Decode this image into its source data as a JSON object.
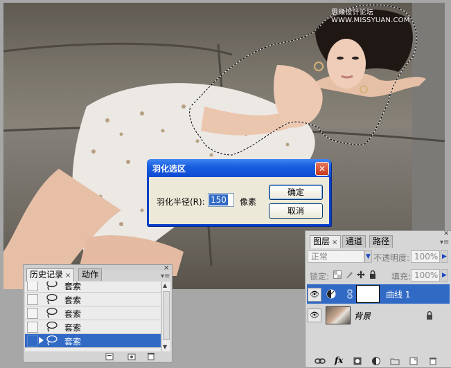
{
  "watermark": "思缘设计论坛 WWW.MISSYUAN.COM",
  "feather_dialog": {
    "title": "羽化选区",
    "radius_label": "羽化半径(R):",
    "radius_value": "150",
    "unit": "像素",
    "ok_label": "确定",
    "cancel_label": "取消",
    "close_glyph": "✕"
  },
  "history_panel": {
    "tabs": [
      {
        "label": "历史记录",
        "close": "×"
      },
      {
        "label": "动作"
      }
    ],
    "close_glyph": "×",
    "menu_glyph": "▾≡",
    "items": [
      {
        "label": "套索"
      },
      {
        "label": "套索"
      },
      {
        "label": "套索"
      },
      {
        "label": "套索"
      },
      {
        "label": "套索",
        "selected": true
      }
    ],
    "footer_icons": [
      "new-document-from-state-icon",
      "new-snapshot-icon",
      "delete-state-icon"
    ]
  },
  "layers_panel": {
    "tabs": [
      {
        "label": "图层",
        "close": "×"
      },
      {
        "label": "通道"
      },
      {
        "label": "路径"
      }
    ],
    "close_glyph": "×",
    "menu_glyph": "▾≡",
    "blend_mode": "正常",
    "opacity_label": "不透明度:",
    "opacity_value": "100%",
    "lock_label": "锁定:",
    "fill_label": "填充:",
    "fill_value": "100%",
    "layers": [
      {
        "name": "曲线 1",
        "type": "adjustment",
        "selected": true
      },
      {
        "name": "背景",
        "type": "image",
        "locked": true
      }
    ],
    "footer_icons": [
      "link-layers-icon",
      "fx-icon",
      "add-mask-icon",
      "adjustment-layer-icon",
      "new-group-icon",
      "new-layer-icon",
      "delete-layer-icon"
    ],
    "fx_glyph": "fx"
  },
  "colors": {
    "selection_blue": "#316ac5",
    "dialog_title_blue": "#0d4bd2",
    "dialog_face": "#ece9d8"
  }
}
